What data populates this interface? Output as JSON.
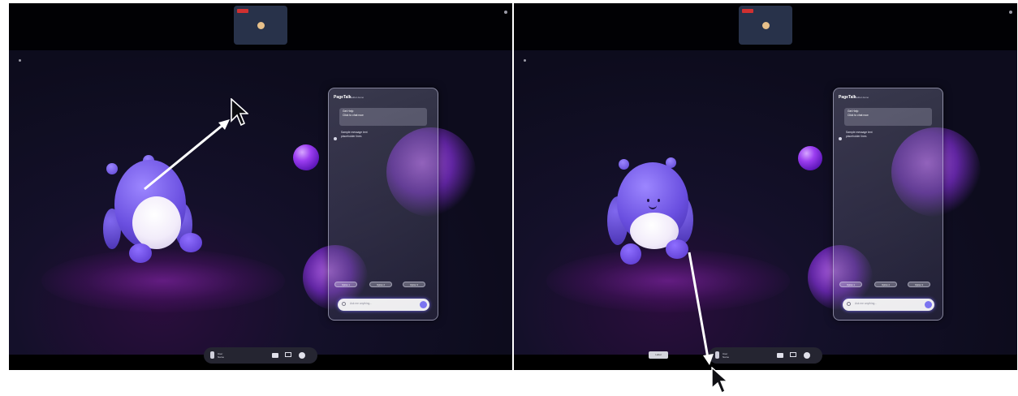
{
  "colors": {
    "topbar": "#010104",
    "scene": "#0d0c1d",
    "accent_purple": "#9b3df0",
    "creature_body": "#6a4fe0",
    "annotation_arrow": "#ffffff"
  },
  "panels": [
    {
      "id": "before",
      "chat": {
        "brand": "PageTalk",
        "tagline": "chatbot demo",
        "card_lines": [
          "Get Help",
          "Click to chat now"
        ],
        "message_lines": [
          "Sample message text",
          "placeholder lines"
        ],
        "chips": [
          "Option 1",
          "Option 2",
          "Option 3"
        ],
        "input_placeholder": "Ask me anything..."
      },
      "dock": {
        "name_lines": [
          "User",
          "Name"
        ]
      },
      "icons": [
        "record-icon",
        "user-icon",
        "camera-icon",
        "screen-share-icon",
        "more-icon",
        "search-icon",
        "send-icon",
        "mouse-cursor-icon"
      ]
    },
    {
      "id": "after",
      "chat": {
        "brand": "PageTalk",
        "tagline": "chatbot demo",
        "card_lines": [
          "Get Help",
          "Click to chat now"
        ],
        "message_lines": [
          "Sample message text",
          "placeholder lines"
        ],
        "chips": [
          "Option 1",
          "Option 2",
          "Option 3"
        ],
        "input_placeholder": "Ask me anything..."
      },
      "dock": {
        "name_lines": [
          "User",
          "Name"
        ]
      },
      "label_chip": "Label",
      "icons": [
        "record-icon",
        "user-icon",
        "camera-icon",
        "screen-share-icon",
        "more-icon",
        "search-icon",
        "send-icon",
        "mouse-cursor-icon"
      ]
    }
  ]
}
